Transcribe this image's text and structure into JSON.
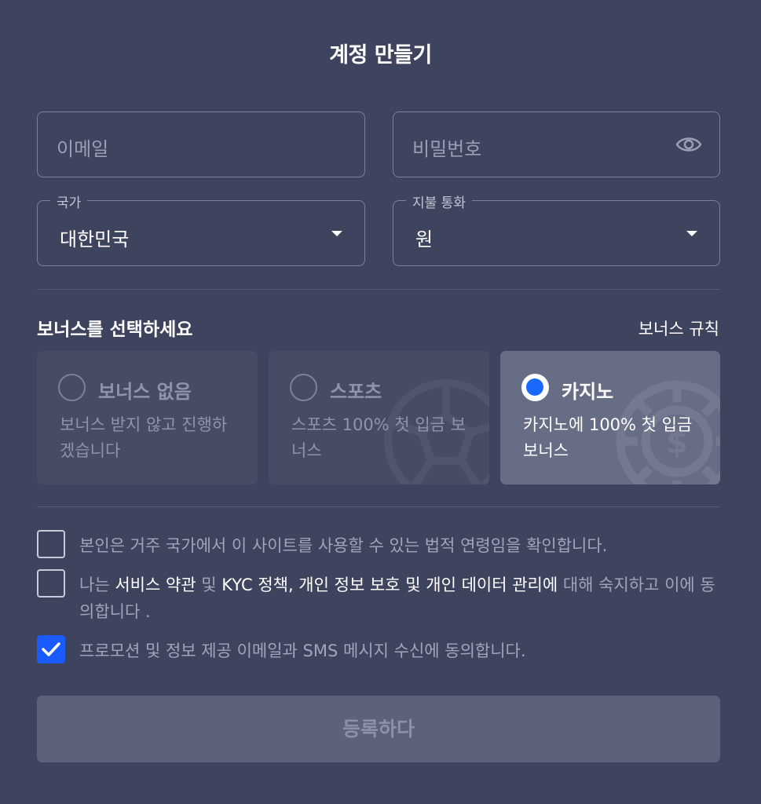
{
  "title": "계정 만들기",
  "email": {
    "placeholder": "이메일"
  },
  "password": {
    "placeholder": "비밀번호"
  },
  "country": {
    "legend": "국가",
    "value": "대한민국"
  },
  "currency": {
    "legend": "지불 통화",
    "value": "원"
  },
  "bonus": {
    "heading": "보너스를 선택하세요",
    "rules_link": "보너스 규칙",
    "options": [
      {
        "label": "보너스 없음",
        "desc": "보너스 받지 않고 진행하겠습니다",
        "selected": false
      },
      {
        "label": "스포츠",
        "desc": "스포츠 100% 첫 입금 보너스",
        "selected": false
      },
      {
        "label": "카지노",
        "desc": "카지노에 100% 첫 입금 보너스",
        "selected": true
      }
    ]
  },
  "agreements": {
    "age": {
      "text": "본인은 거주 국가에서 이 사이트를 사용할 수 있는 법적 연령임을 확인합니다.",
      "checked": false
    },
    "terms": {
      "prefix": "나는 ",
      "link1": "서비스 약관",
      "and1": " 및 ",
      "link2": "KYC 정책, 개인 정보 보호 및 개인 데이터 관리에",
      "suffix": " 대해 숙지하고 이에 동의합니다 .",
      "checked": false
    },
    "promo": {
      "text": "프로모션 및 정보 제공 이메일과 SMS 메시지 수신에 동의합니다.",
      "checked": true
    }
  },
  "submit_label": "등록하다",
  "colors": {
    "background": "#3f445e",
    "accent": "#1a5bff",
    "selected_card": "#686d86"
  },
  "icons": [
    "eye-icon",
    "chevron-down-icon",
    "radio-icon",
    "checkmark-icon",
    "sports-ball-icon",
    "casino-chip-icon"
  ]
}
